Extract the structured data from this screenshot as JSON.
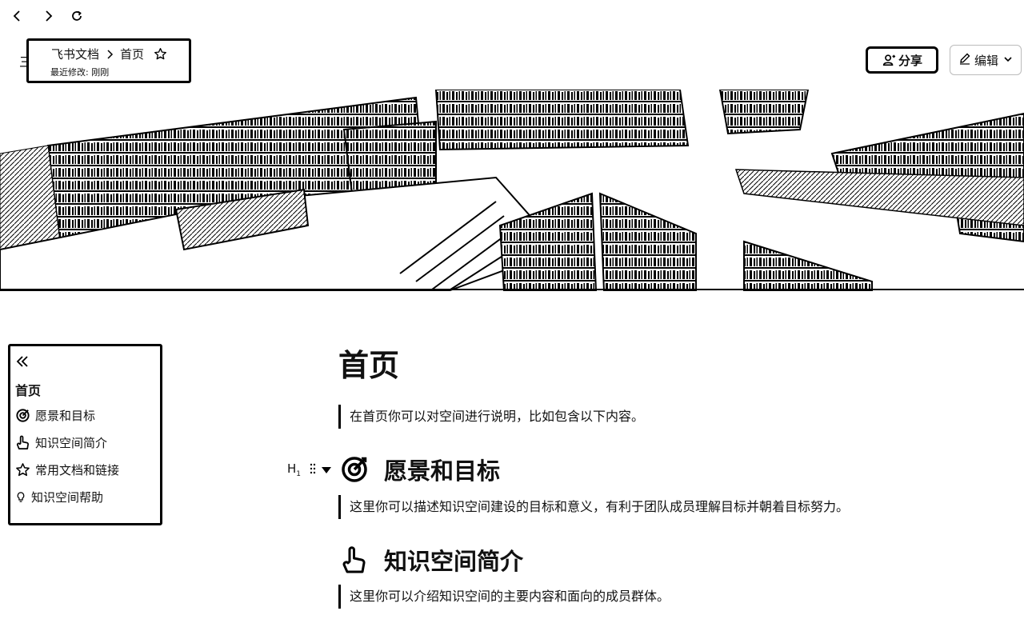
{
  "nav": {
    "back_icon": "chevron-left-icon",
    "forward_icon": "chevron-right-icon",
    "reload_icon": "reload-icon"
  },
  "header": {
    "menu_glyph": "三",
    "breadcrumb": {
      "root": "飞书文档",
      "current": "首页"
    },
    "last_modified": "最近修改: 刚刚",
    "share_label": "分享",
    "edit_label": "编辑"
  },
  "toc": {
    "title": "首页",
    "items": [
      {
        "label": "愿景和目标",
        "icon": "target-icon"
      },
      {
        "label": "知识空间简介",
        "icon": "hand-pointer-icon"
      },
      {
        "label": "常用文档和链接",
        "icon": "star-icon"
      },
      {
        "label": "知识空间帮助",
        "icon": "lightbulb-icon"
      }
    ]
  },
  "doc": {
    "title": "首页",
    "intro": "在首页你可以对空间进行说明，比如包含以下内容。",
    "block_tool_label": "H",
    "block_tool_sub": "1",
    "sections": [
      {
        "heading": "愿景和目标",
        "icon": "target-icon",
        "text": "这里你可以描述知识空间建设的目标和意义，有利于团队成员理解目标并朝着目标努力。"
      },
      {
        "heading": "知识空间简介",
        "icon": "hand-pointer-icon",
        "text": "这里你可以介绍知识空间的主要内容和面向的成员群体。"
      }
    ]
  },
  "colors": {
    "ink": "#000000",
    "paper": "#ffffff",
    "border": "#bbbbbb"
  }
}
